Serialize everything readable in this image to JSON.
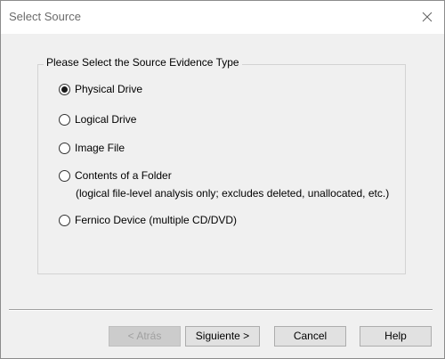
{
  "window": {
    "title": "Select Source"
  },
  "group": {
    "label": "Please Select the Source Evidence Type",
    "options": [
      {
        "label": "Physical Drive",
        "selected": true
      },
      {
        "label": "Logical Drive",
        "selected": false
      },
      {
        "label": "Image File",
        "selected": false
      },
      {
        "label": "Contents of a Folder",
        "selected": false,
        "note": "(logical file-level analysis only; excludes deleted, unallocated, etc.)"
      },
      {
        "label": "Fernico Device (multiple CD/DVD)",
        "selected": false
      }
    ]
  },
  "buttons": {
    "back": "< Atrás",
    "next": "Siguiente >",
    "cancel": "Cancel",
    "help": "Help"
  },
  "icons": {
    "close": "close-icon"
  }
}
